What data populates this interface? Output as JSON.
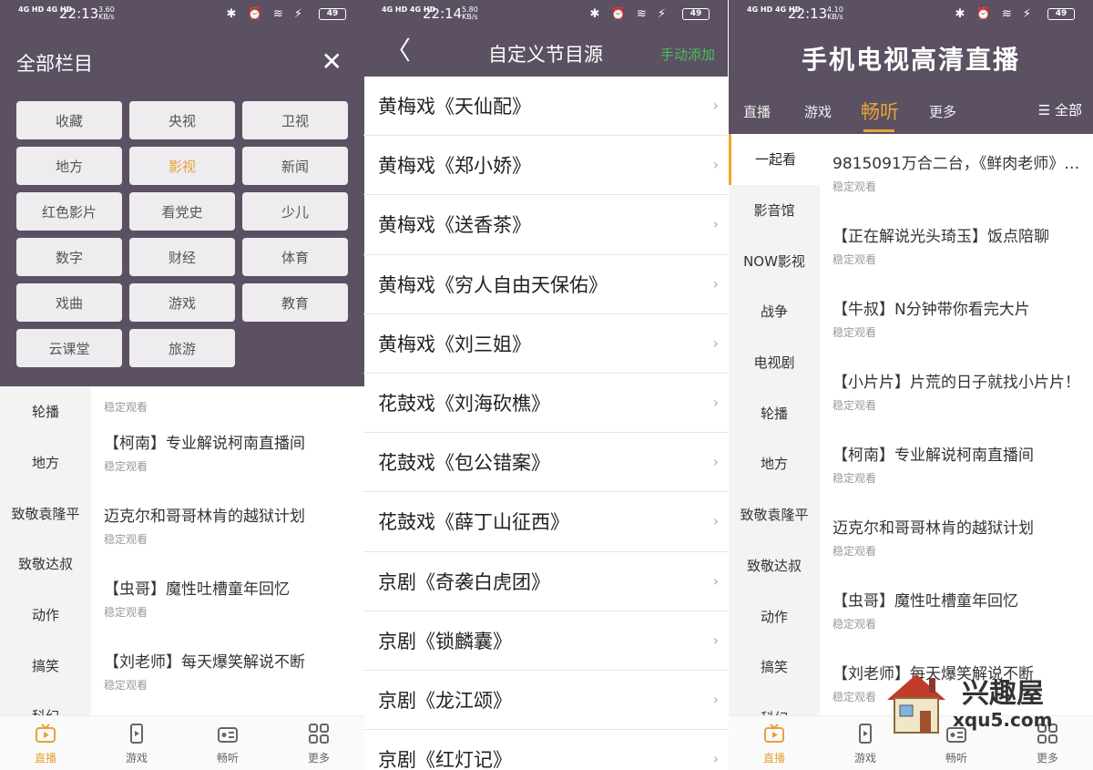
{
  "colors": {
    "header_bg": "#5b5162",
    "accent": "#e8a238",
    "add_green": "#4dbb5c"
  },
  "p1": {
    "status": {
      "signal": "4G HD 4G HD",
      "time": "22:13",
      "speed_top": "3.60",
      "speed_bot": "KB/s",
      "icons": "✱ ⏰ ≋ ⚡",
      "battery": "49"
    },
    "title": "全部栏目",
    "grid": [
      "收藏",
      "央视",
      "卫视",
      "地方",
      "影视",
      "新闻",
      "红色影片",
      "看党史",
      "少儿",
      "数字",
      "财经",
      "体育",
      "戏曲",
      "游戏",
      "教育",
      "云课堂",
      "旅游"
    ],
    "selected": "影视",
    "side": [
      "轮播",
      "地方",
      "致敬袁隆平",
      "致敬达叔",
      "动作",
      "搞笑",
      "科幻"
    ],
    "first_sub": "稳定观看",
    "list": [
      {
        "title": "【柯南】专业解说柯南直播间",
        "sub": "稳定观看"
      },
      {
        "title": "迈克尔和哥哥林肯的越狱计划",
        "sub": "稳定观看"
      },
      {
        "title": "【虫哥】魔性吐槽童年回忆",
        "sub": "稳定观看"
      },
      {
        "title": "【刘老师】每天爆笑解说不断",
        "sub": "稳定观看"
      }
    ],
    "tabs": [
      "直播",
      "游戏",
      "畅听",
      "更多"
    ]
  },
  "p2": {
    "status": {
      "signal": "4G HD 4G HD",
      "time": "22:14",
      "speed_top": "5.80",
      "speed_bot": "KB/s",
      "icons": "✱ ⏰ ≋ ⚡",
      "battery": "49"
    },
    "back": "〈",
    "title": "自定义节目源",
    "add": "手动添加",
    "items": [
      "黄梅戏《天仙配》",
      "黄梅戏《郑小娇》",
      "黄梅戏《送香茶》",
      "黄梅戏《穷人自由天保佑》",
      "黄梅戏《刘三姐》",
      "花鼓戏《刘海砍樵》",
      "花鼓戏《包公错案》",
      "花鼓戏《薛丁山征西》",
      "京剧《奇袭白虎团》",
      "京剧《锁麟囊》",
      "京剧《龙江颂》",
      "京剧《红灯记》"
    ]
  },
  "p3": {
    "status": {
      "signal": "4G HD 4G HD",
      "time": "22:13",
      "speed_top": "4.10",
      "speed_bot": "KB/s",
      "icons": "✱ ⏰ ≋ ⚡",
      "battery": "49"
    },
    "title": "手机电视高清直播",
    "tabs": [
      "直播",
      "游戏",
      "畅听",
      "更多"
    ],
    "all": "☰ 全部",
    "side": [
      "一起看",
      "影音馆",
      "NOW影视",
      "战争",
      "电视剧",
      "轮播",
      "地方",
      "致敬袁隆平",
      "致敬达叔",
      "动作",
      "搞笑",
      "科幻"
    ],
    "list": [
      {
        "title": "9815091万合二台，《鲜肉老师》…",
        "sub": "稳定观看"
      },
      {
        "title": "【正在解说光头琦玉】饭点陪聊",
        "sub": "稳定观看"
      },
      {
        "title": "【牛叔】N分钟带你看完大片",
        "sub": "稳定观看"
      },
      {
        "title": "【小片片】片荒的日子就找小片片！",
        "sub": "稳定观看"
      },
      {
        "title": "【柯南】专业解说柯南直播间",
        "sub": "稳定观看"
      },
      {
        "title": "迈克尔和哥哥林肯的越狱计划",
        "sub": "稳定观看"
      },
      {
        "title": "【虫哥】魔性吐槽童年回忆",
        "sub": "稳定观看"
      },
      {
        "title": "【刘老师】每天爆笑解说不断",
        "sub": "稳定观看"
      }
    ],
    "watermark": {
      "name": "兴趣屋",
      "url": "xqu5.com"
    }
  }
}
